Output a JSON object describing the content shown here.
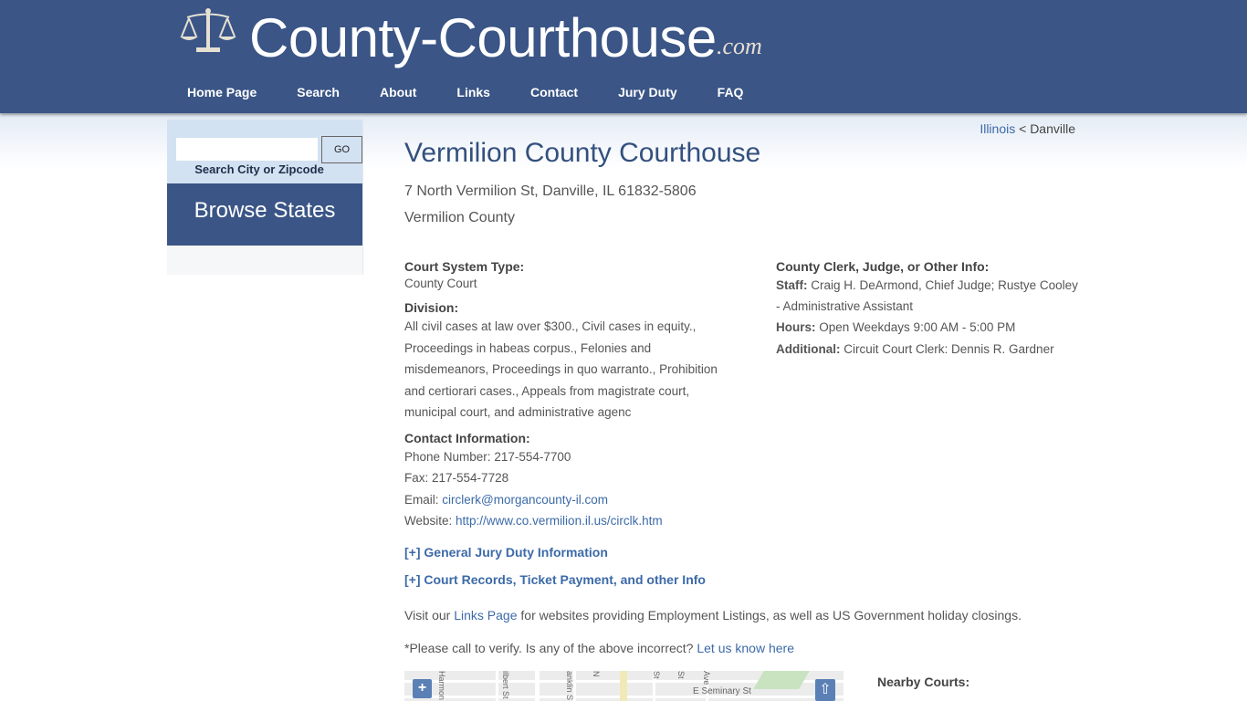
{
  "header": {
    "logo_text": "County-Courthouse",
    "logo_tld": ".com",
    "logo_icon": "scales-of-justice-icon",
    "nav": [
      {
        "label": "Home Page"
      },
      {
        "label": "Search"
      },
      {
        "label": "About"
      },
      {
        "label": "Links"
      },
      {
        "label": "Contact"
      },
      {
        "label": "Jury Duty"
      },
      {
        "label": "FAQ"
      }
    ]
  },
  "sidebar": {
    "search_value": "",
    "go_label": "GO",
    "search_label": "Search City or Zipcode",
    "browse_label": "Browse States"
  },
  "breadcrumb": {
    "state": "Illinois",
    "separator": " < ",
    "city": "Danville"
  },
  "main": {
    "title": "Vermilion County Courthouse",
    "address": "7 North Vermilion St, Danville, IL 61832-5806",
    "county": "Vermilion County"
  },
  "details": {
    "court_type_label": "Court System Type:",
    "court_type_value": "County Court",
    "division_label": "Division:",
    "division_value": "All civil cases at law over $300., Civil cases in equity., Proceedings in habeas corpus., Felonies and misdemeanors, Proceedings in quo warranto., Prohibition and certiorari cases., Appeals from magistrate court, municipal court, and administrative agenc",
    "contact_label": "Contact Information:",
    "phone_label": "Phone Number: ",
    "phone": "217-554-7700",
    "fax_label": "Fax: ",
    "fax": "217-554-7728",
    "email_label": "Email: ",
    "email": "circlerk@morgancounty-il.com",
    "website_label": "Website: ",
    "website": "http://www.co.vermilion.il.us/circlk.htm",
    "jury_expander": "[+] General Jury Duty Information",
    "records_expander": "[+] Court Records, Ticket Payment, and other Info"
  },
  "other_info": {
    "heading": "County Clerk, Judge, or Other Info:",
    "staff_label": "Staff:",
    "staff": " Craig H. DeArmond, Chief Judge; Rustye Cooley - Administrative Assistant",
    "hours_label": "Hours:",
    "hours": " Open Weekdays 9:00 AM - 5:00 PM",
    "additional_label": "Additional:",
    "additional": " Circuit Court Clerk: Dennis R. Gardner"
  },
  "notice": {
    "visit_prefix": "Visit our ",
    "links_page": "Links Page",
    "visit_suffix": " for websites providing Employment Listings, as well as US Government holiday closings.",
    "verify_text": "*Please call to verify. Is any of the above incorrect? ",
    "let_us_know": "Let us know here"
  },
  "map": {
    "zoom_in": "+",
    "scroll_top": "⇧",
    "streets": [
      "Harmon",
      "ilbert St",
      "anklin S",
      "N",
      "St",
      "St",
      "Ave",
      "E Seminary St"
    ]
  },
  "nearby": {
    "heading": "Nearby Courts:"
  }
}
